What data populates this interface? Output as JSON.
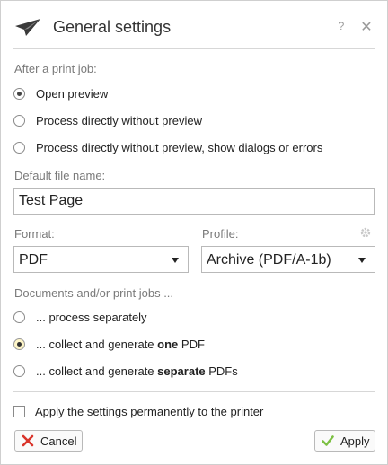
{
  "dialog": {
    "title": "General settings",
    "help_glyph": "?",
    "close_glyph": "✕"
  },
  "after_print": {
    "label": "After a print job:",
    "options": [
      {
        "label": "Open preview",
        "checked": true
      },
      {
        "label": "Process directly without preview",
        "checked": false
      },
      {
        "label": "Process directly without preview, show dialogs or errors",
        "checked": false
      }
    ]
  },
  "file_name": {
    "label": "Default file name:",
    "value": "Test Page"
  },
  "format": {
    "label": "Format:",
    "value": "PDF"
  },
  "profile": {
    "label": "Profile:",
    "value": "Archive (PDF/A-1b)"
  },
  "documents": {
    "label": "Documents and/or print jobs ...",
    "options": [
      {
        "prefix": "... process separately",
        "bold": "",
        "suffix": "",
        "checked": false
      },
      {
        "prefix": "... collect and generate ",
        "bold": "one",
        "suffix": " PDF",
        "checked": true
      },
      {
        "prefix": "... collect and generate ",
        "bold": "separate",
        "suffix": " PDFs",
        "checked": false
      }
    ]
  },
  "apply_permanently": {
    "label": "Apply the settings permanently to the printer",
    "checked": false
  },
  "buttons": {
    "cancel_label": "Cancel",
    "apply_label": "Apply"
  },
  "icons": {
    "title": "paper-plane-icon",
    "help": "help-icon",
    "close": "close-icon",
    "gear": "gear-icon",
    "cancel": "x-mark-icon",
    "apply": "checkmark-icon"
  },
  "colors": {
    "cancel_icon": "#d9342b",
    "apply_icon": "#7cc043",
    "selected_radio_highlight": "#fff6c8"
  }
}
